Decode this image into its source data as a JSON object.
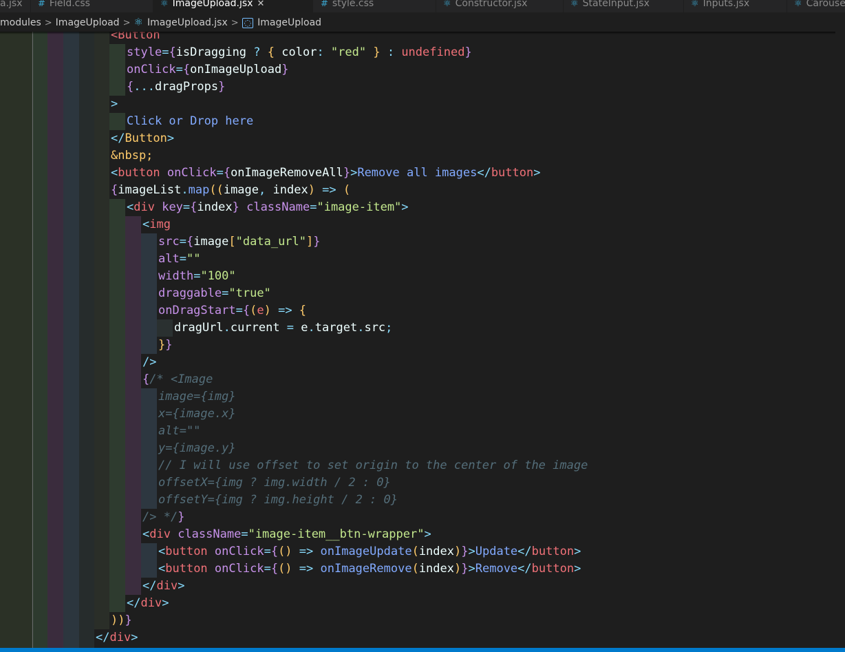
{
  "tabs": [
    {
      "label": "a.jsx",
      "active": false,
      "icon": "react-icon"
    },
    {
      "label": "Field.css",
      "active": false,
      "icon": "css-icon"
    },
    {
      "label": "ImageUpload.jsx",
      "active": true,
      "icon": "react-icon"
    },
    {
      "label": "style.css",
      "active": false,
      "icon": "css-icon"
    },
    {
      "label": "Constructor.jsx",
      "active": false,
      "icon": "react-icon"
    },
    {
      "label": "StateInput.jsx",
      "active": false,
      "icon": "react-icon"
    },
    {
      "label": "Inputs.jsx",
      "active": false,
      "icon": "react-icon"
    },
    {
      "label": "Carousel.jsx",
      "active": false,
      "icon": "react-icon"
    }
  ],
  "breadcrumb": {
    "items": [
      "modules",
      "ImageUpload",
      "ImageUpload.jsx",
      "ImageUpload"
    ],
    "separator": ">"
  },
  "code_lines": [
    {
      "indent": 7,
      "tokens": [
        [
          "tg",
          "<Button"
        ]
      ]
    },
    {
      "indent": 8,
      "tokens": [
        [
          "at",
          "style"
        ],
        [
          "kw",
          "="
        ],
        [
          "br1",
          "{"
        ],
        [
          "vr",
          "isDragging "
        ],
        [
          "kw",
          "? "
        ],
        [
          "br2",
          "{ "
        ],
        [
          "vr",
          "color"
        ],
        [
          "kw",
          ": "
        ],
        [
          "st",
          "\"red\""
        ],
        [
          "br2",
          " }"
        ],
        [
          "kw",
          " : "
        ],
        [
          "tg",
          "undefined"
        ],
        [
          "br1",
          "}"
        ]
      ]
    },
    {
      "indent": 8,
      "tokens": [
        [
          "at",
          "onClick"
        ],
        [
          "kw",
          "="
        ],
        [
          "br1",
          "{"
        ],
        [
          "vr",
          "onImageUpload"
        ],
        [
          "br1",
          "}"
        ]
      ]
    },
    {
      "indent": 8,
      "tokens": [
        [
          "br1",
          "{"
        ],
        [
          "kw",
          "..."
        ],
        [
          "vr",
          "dragProps"
        ],
        [
          "br1",
          "}"
        ]
      ]
    },
    {
      "indent": 7,
      "tokens": [
        [
          "kw",
          ">"
        ]
      ]
    },
    {
      "indent": 8,
      "tokens": [
        [
          "txt",
          "Click or Drop here"
        ]
      ]
    },
    {
      "indent": 7,
      "tokens": [
        [
          "kw",
          "</"
        ],
        [
          "ent",
          "Button"
        ],
        [
          "kw",
          ">"
        ]
      ]
    },
    {
      "indent": 7,
      "tokens": [
        [
          "ent",
          "&nbsp;"
        ]
      ]
    },
    {
      "indent": 7,
      "tokens": [
        [
          "kw",
          "<"
        ],
        [
          "tg",
          "button"
        ],
        [
          "at",
          " onClick"
        ],
        [
          "kw",
          "="
        ],
        [
          "br1",
          "{"
        ],
        [
          "vr",
          "onImageRemoveAll"
        ],
        [
          "br1",
          "}"
        ],
        [
          "kw",
          ">"
        ],
        [
          "txt",
          "Remove all images"
        ],
        [
          "kw",
          "</"
        ],
        [
          "tg",
          "button"
        ],
        [
          "kw",
          ">"
        ]
      ]
    },
    {
      "indent": 7,
      "tokens": [
        [
          "br1",
          "{"
        ],
        [
          "vr",
          "imageList"
        ],
        [
          "kw",
          "."
        ],
        [
          "fn",
          "map"
        ],
        [
          "br2",
          "(("
        ],
        [
          "vr",
          "image"
        ],
        [
          "kw",
          ", "
        ],
        [
          "vr",
          "index"
        ],
        [
          "br2",
          ")"
        ],
        [
          "kw",
          " => "
        ],
        [
          "br2",
          "("
        ]
      ]
    },
    {
      "indent": 8,
      "tokens": [
        [
          "kw",
          "<"
        ],
        [
          "tg",
          "div"
        ],
        [
          "at",
          " key"
        ],
        [
          "kw",
          "="
        ],
        [
          "br1",
          "{"
        ],
        [
          "vr",
          "index"
        ],
        [
          "br1",
          "}"
        ],
        [
          "at",
          " className"
        ],
        [
          "kw",
          "="
        ],
        [
          "st",
          "\"image-item\""
        ],
        [
          "kw",
          ">"
        ]
      ]
    },
    {
      "indent": 9,
      "tokens": [
        [
          "kw",
          "<"
        ],
        [
          "tg",
          "img"
        ]
      ]
    },
    {
      "indent": 10,
      "tokens": [
        [
          "at",
          "src"
        ],
        [
          "kw",
          "="
        ],
        [
          "br1",
          "{"
        ],
        [
          "vr",
          "image"
        ],
        [
          "br2",
          "["
        ],
        [
          "st",
          "\"data_url\""
        ],
        [
          "br2",
          "]"
        ],
        [
          "br1",
          "}"
        ]
      ]
    },
    {
      "indent": 10,
      "tokens": [
        [
          "at",
          "alt"
        ],
        [
          "kw",
          "="
        ],
        [
          "st",
          "\"\""
        ]
      ]
    },
    {
      "indent": 10,
      "tokens": [
        [
          "at",
          "width"
        ],
        [
          "kw",
          "="
        ],
        [
          "st",
          "\"100\""
        ]
      ]
    },
    {
      "indent": 10,
      "tokens": [
        [
          "at",
          "draggable"
        ],
        [
          "kw",
          "="
        ],
        [
          "st",
          "\"true\""
        ]
      ]
    },
    {
      "indent": 10,
      "tokens": [
        [
          "at",
          "onDragStart"
        ],
        [
          "kw",
          "="
        ],
        [
          "br1",
          "{"
        ],
        [
          "br2",
          "("
        ],
        [
          "tg",
          "e"
        ],
        [
          "br2",
          ")"
        ],
        [
          "kw",
          " => "
        ],
        [
          "br2",
          "{"
        ]
      ]
    },
    {
      "indent": 11,
      "tokens": [
        [
          "vr",
          "dragUrl"
        ],
        [
          "kw",
          "."
        ],
        [
          "vr",
          "current "
        ],
        [
          "kw",
          "= "
        ],
        [
          "vr",
          "e"
        ],
        [
          "kw",
          "."
        ],
        [
          "vr",
          "target"
        ],
        [
          "kw",
          "."
        ],
        [
          "vr",
          "src"
        ],
        [
          "kw",
          ";"
        ]
      ]
    },
    {
      "indent": 10,
      "tokens": [
        [
          "br2",
          "}"
        ],
        [
          "br1",
          "}"
        ]
      ]
    },
    {
      "indent": 9,
      "tokens": [
        [
          "kw",
          "/>"
        ]
      ]
    },
    {
      "indent": 9,
      "tokens": [
        [
          "br1",
          "{"
        ],
        [
          "cm",
          "/* <Image"
        ]
      ]
    },
    {
      "indent": 10,
      "tokens": [
        [
          "cm",
          "image={img}"
        ]
      ]
    },
    {
      "indent": 10,
      "tokens": [
        [
          "cm",
          "x={image.x}"
        ]
      ]
    },
    {
      "indent": 10,
      "tokens": [
        [
          "cm",
          "alt=\"\""
        ]
      ]
    },
    {
      "indent": 10,
      "tokens": [
        [
          "cm",
          "y={image.y}"
        ]
      ]
    },
    {
      "indent": 10,
      "tokens": [
        [
          "cm",
          "// I will use offset to set origin to the center of the image"
        ]
      ]
    },
    {
      "indent": 10,
      "tokens": [
        [
          "cm",
          "offsetX={img ? img.width / 2 : 0}"
        ]
      ]
    },
    {
      "indent": 10,
      "tokens": [
        [
          "cm",
          "offsetY={img ? img.height / 2 : 0}"
        ]
      ]
    },
    {
      "indent": 9,
      "tokens": [
        [
          "cm",
          "/> */"
        ],
        [
          "br1",
          "}"
        ]
      ]
    },
    {
      "indent": 9,
      "tokens": [
        [
          "kw",
          "<"
        ],
        [
          "tg",
          "div"
        ],
        [
          "at",
          " className"
        ],
        [
          "kw",
          "="
        ],
        [
          "st",
          "\"image-item__btn-wrapper\""
        ],
        [
          "kw",
          ">"
        ]
      ]
    },
    {
      "indent": 10,
      "tokens": [
        [
          "kw",
          "<"
        ],
        [
          "tg",
          "button"
        ],
        [
          "at",
          " onClick"
        ],
        [
          "kw",
          "="
        ],
        [
          "br1",
          "{"
        ],
        [
          "br2",
          "()"
        ],
        [
          "kw",
          " => "
        ],
        [
          "fn",
          "onImageUpdate"
        ],
        [
          "br2",
          "("
        ],
        [
          "vr",
          "index"
        ],
        [
          "br2",
          ")"
        ],
        [
          "br1",
          "}"
        ],
        [
          "kw",
          ">"
        ],
        [
          "txt",
          "Update"
        ],
        [
          "kw",
          "</"
        ],
        [
          "tg",
          "button"
        ],
        [
          "kw",
          ">"
        ]
      ]
    },
    {
      "indent": 10,
      "tokens": [
        [
          "kw",
          "<"
        ],
        [
          "tg",
          "button"
        ],
        [
          "at",
          " onClick"
        ],
        [
          "kw",
          "="
        ],
        [
          "br1",
          "{"
        ],
        [
          "br2",
          "()"
        ],
        [
          "kw",
          " => "
        ],
        [
          "fn",
          "onImageRemove"
        ],
        [
          "br2",
          "("
        ],
        [
          "vr",
          "index"
        ],
        [
          "br2",
          ")"
        ],
        [
          "br1",
          "}"
        ],
        [
          "kw",
          ">"
        ],
        [
          "txt",
          "Remove"
        ],
        [
          "kw",
          "</"
        ],
        [
          "tg",
          "button"
        ],
        [
          "kw",
          ">"
        ]
      ]
    },
    {
      "indent": 9,
      "tokens": [
        [
          "kw",
          "</"
        ],
        [
          "tg",
          "div"
        ],
        [
          "kw",
          ">"
        ]
      ]
    },
    {
      "indent": 8,
      "tokens": [
        [
          "kw",
          "</"
        ],
        [
          "tg",
          "div"
        ],
        [
          "kw",
          ">"
        ]
      ]
    },
    {
      "indent": 7,
      "tokens": [
        [
          "br2",
          "))"
        ],
        [
          "br1",
          "}"
        ]
      ]
    },
    {
      "indent": 6,
      "tokens": [
        [
          "kw",
          "</"
        ],
        [
          "tg",
          "div"
        ],
        [
          "kw",
          ">"
        ]
      ]
    }
  ]
}
